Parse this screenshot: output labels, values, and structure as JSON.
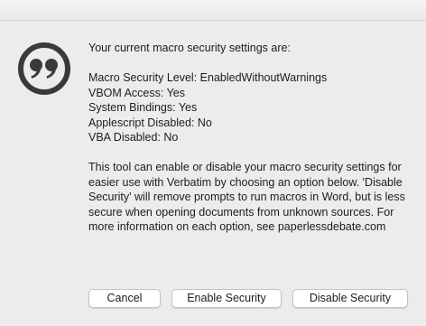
{
  "dialog": {
    "icon": "quotation-marks-icon",
    "heading": "Your current macro security settings are:",
    "settings": [
      "Macro Security Level: EnabledWithoutWarnings",
      "VBOM Access: Yes",
      "System Bindings: Yes",
      "Applescript Disabled: No",
      "VBA Disabled: No"
    ],
    "description": "This tool can enable or disable your macro security settings for easier use with Verbatim by choosing an option below. 'Disable Security' will remove prompts to run macros in Word, but is less secure when opening documents from unknown sources. For more information on each option, see paperlessdebate.com"
  },
  "buttons": {
    "cancel_label": "Cancel",
    "enable_label": "Enable Security",
    "disable_label": "Disable Security"
  }
}
